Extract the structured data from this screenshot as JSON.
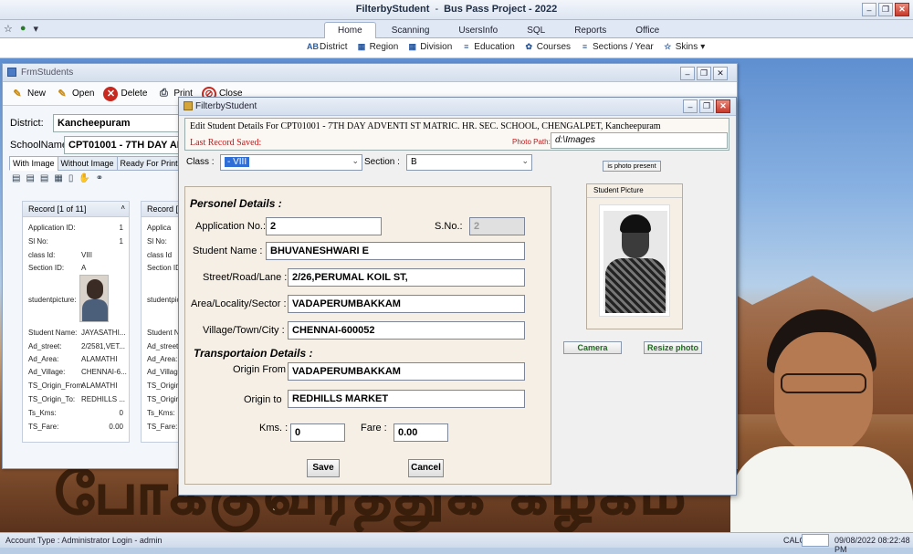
{
  "app": {
    "title_left": "FilterbyStudent",
    "title_sep": "-",
    "title_right": "Bus Pass Project - 2022"
  },
  "ribbon": {
    "tabs": [
      "Home",
      "Scanning",
      "UsersInfo",
      "SQL",
      "Reports",
      "Office"
    ],
    "items": [
      "District",
      "Region",
      "Division",
      "Education",
      "Courses",
      "Sections / Year",
      "Skins"
    ]
  },
  "banner": {
    "text": "போக்குவரத்துக் கழகம்"
  },
  "statusbar": {
    "account": "Account Type : Administrator Login - admin",
    "calc": "CALC",
    "datetime": "09/08/2022 08:22:48 PM"
  },
  "frm_students": {
    "title": "FrmStudents",
    "toolbar": [
      "New",
      "Open",
      "Delete",
      "Print",
      "Close"
    ],
    "district_label": "District:",
    "district_value": "Kancheepuram",
    "school_label": "SchoolName:",
    "school_value": "CPT01001 - 7TH DAY ADVENTI",
    "tabs": [
      "With Image",
      "Without Image",
      "Ready For Print"
    ],
    "record1": {
      "header": "Record [1 of 11]",
      "labels": [
        "Application ID:",
        "Sl No:",
        "class Id:",
        "Section ID:",
        "studentpicture:",
        "Student Name:",
        "Ad_street:",
        "Ad_Area:",
        "Ad_Village:",
        "TS_Origin_From:",
        "TS_Origin_To:",
        "Ts_Kms:",
        "TS_Fare:"
      ],
      "values": [
        "1",
        "1",
        "VIII",
        "A",
        "",
        "JAYASATHI...",
        "2/2581,VET...",
        "ALAMATHI",
        "CHENNAI-6...",
        "ALAMATHI",
        "REDHILLS ...",
        "0",
        "0.00"
      ]
    },
    "record2": {
      "header": "Record [2",
      "labels": [
        "Applica",
        "Sl No:",
        "class Id",
        "Section ID",
        "studentpic",
        "Student N",
        "Ad_street",
        "Ad_Area:",
        "Ad_Village",
        "TS_Origin",
        "TS_Origin",
        "Ts_Kms:",
        "TS_Fare:"
      ]
    }
  },
  "dialog": {
    "title": "FilterbyStudent",
    "edit_text": "Edit Student Details For CPT01001 - 7TH DAY ADVENTI ST MATRIC. HR. SEC. SCHOOL, CHENGALPET, Kancheepuram",
    "last_saved": "Last Record Saved:",
    "photo_path_label": "Photo Path:",
    "photo_path": "d:\\Images",
    "class_label": "Class :",
    "class_value": "- VIII",
    "section_label": "Section :",
    "section_value": "B",
    "photo_present_btn": "is photo present",
    "personal_header": "Personel Details :",
    "app_no_label": "Application No.:",
    "app_no": "2",
    "sno_label": "S.No.:",
    "sno": "2",
    "name_label": "Student Name :",
    "name": "BHUVANESHWARI E",
    "street_label": "Street/Road/Lane :",
    "street": "2/26,PERUMAL KOIL ST,",
    "area_label": "Area/Locality/Sector :",
    "area": "VADAPERUMBAKKAM",
    "village_label": "Village/Town/City :",
    "village": "CHENNAI-600052",
    "transport_header": "Transportaion Details :",
    "origin_from_label": "Origin From",
    "origin_from": "VADAPERUMBAKKAM",
    "origin_to_label": "Origin to",
    "origin_to": "REDHILLS MARKET",
    "kms_label": "Kms. :",
    "kms": "0",
    "fare_label": "Fare :",
    "fare": "0.00",
    "save": "Save",
    "cancel": "Cancel",
    "picture_header": "Student Picture",
    "camera": "Camera",
    "resize": "Resize photo"
  }
}
